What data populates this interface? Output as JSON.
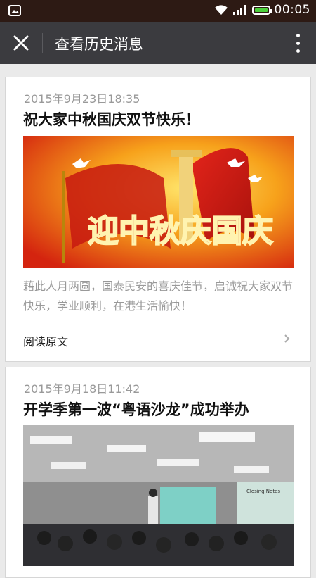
{
  "status_bar": {
    "time": "00:05",
    "icons": [
      "gallery-icon",
      "wifi-icon",
      "signal-icon",
      "battery-icon"
    ],
    "battery_color": "#4cd13c"
  },
  "app_bar": {
    "title": "查看历史消息",
    "close_icon": "close-icon",
    "more_icon": "more-vertical-icon",
    "background": "#3b3b3f"
  },
  "articles": [
    {
      "date": "2015年9月23日18:35",
      "title": "祝大家中秋国庆双节快乐！",
      "image_text": "迎中秋庆国庆",
      "summary": "藉此人月两圆，国泰民安的喜庆佳节，启诚祝大家双节快乐，学业顺利，在港生活愉快！",
      "read_label": "阅读原文"
    },
    {
      "date": "2015年9月18日11:42",
      "title": "开学季第一波“粤语沙龙”成功举办",
      "image_text": "Closing Notes"
    }
  ]
}
